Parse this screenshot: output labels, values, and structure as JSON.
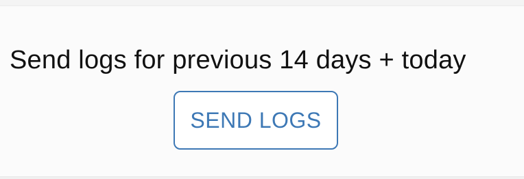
{
  "logs_panel": {
    "description": "Send logs for previous 14 days + today",
    "send_button_label": "SEND LOGS"
  },
  "colors": {
    "accent": "#3d78b5",
    "text": "#111111",
    "background": "#fbfbfb"
  }
}
